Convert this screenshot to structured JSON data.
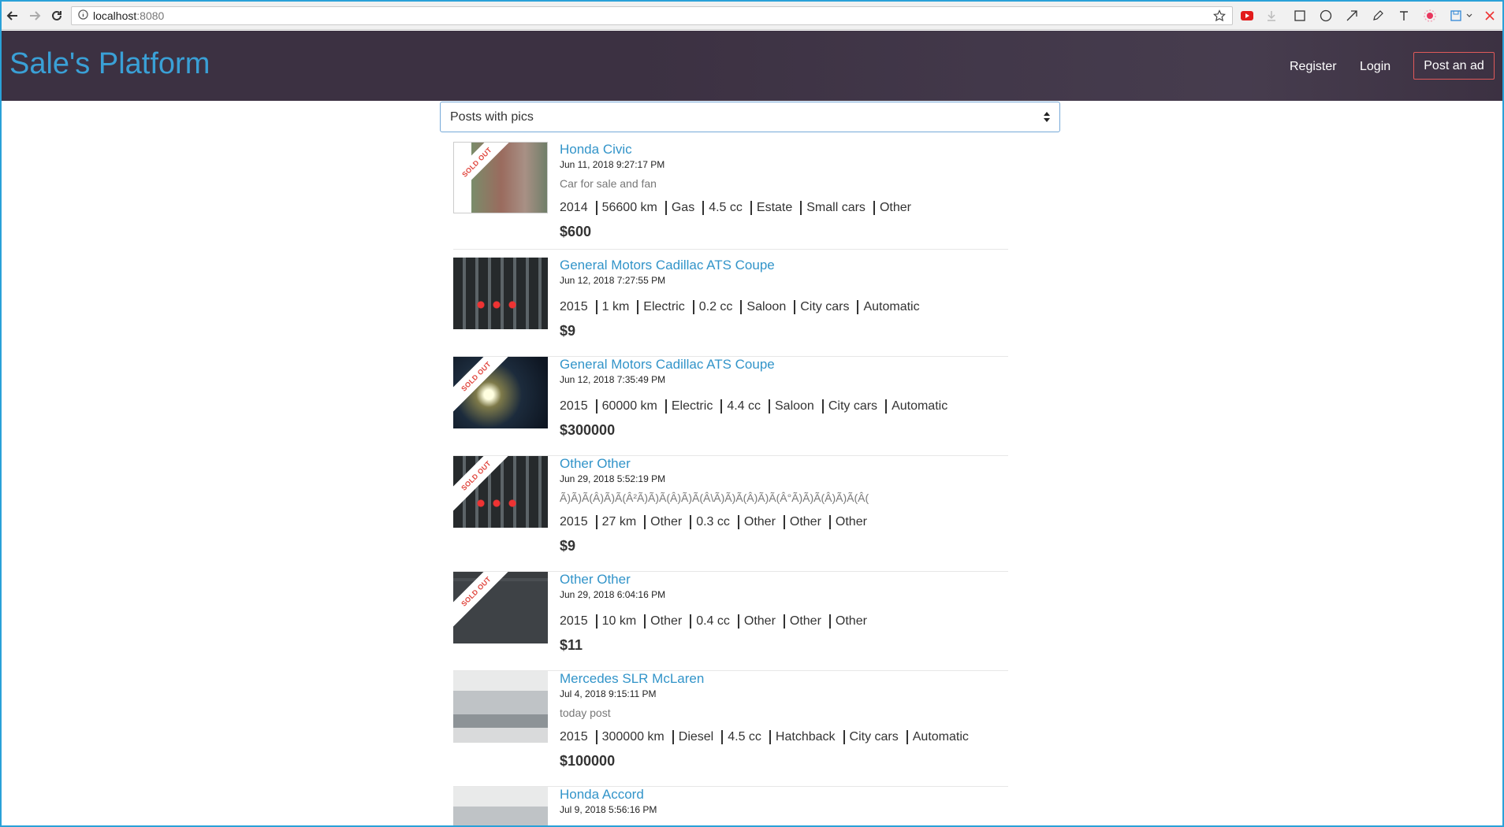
{
  "browser": {
    "url_host": "localhost",
    "url_port": ":8080"
  },
  "navbar": {
    "brand": "Sale's Platform",
    "register": "Register",
    "login": "Login",
    "post_ad": "Post an ad"
  },
  "filter": {
    "selected": "Posts with pics"
  },
  "sold_out_label": "SOLD OUT",
  "listings": [
    {
      "title": "Honda Civic",
      "date": "Jun 11, 2018 9:27:17 PM",
      "description": "Car for sale and fan",
      "specs": [
        "2014",
        "56600 km",
        "Gas",
        "4.5 cc",
        "Estate",
        "Small cars",
        "Other"
      ],
      "price": "$600",
      "sold_out": true,
      "photo": "train"
    },
    {
      "title": "General Motors Cadillac ATS Coupe",
      "date": "Jun 12, 2018 7:27:55 PM",
      "description": "",
      "specs": [
        "2015",
        "1 km",
        "Electric",
        "0.2 cc",
        "Saloon",
        "City cars",
        "Automatic"
      ],
      "price": "$9",
      "sold_out": false,
      "photo": "keyboard"
    },
    {
      "title": "General Motors Cadillac ATS Coupe",
      "date": "Jun 12, 2018 7:35:49 PM",
      "description": "",
      "specs": [
        "2015",
        "60000 km",
        "Electric",
        "4.4 cc",
        "Saloon",
        "City cars",
        "Automatic"
      ],
      "price": "$300000",
      "sold_out": true,
      "photo": "night"
    },
    {
      "title": "Other Other",
      "date": "Jun 29, 2018 5:52:19 PM",
      "description": "Ã)Ã)Ã(Â)Ã)Ã(Â²Ã)Ã)Ã(Â)Ã)Ã(Â\\Ã)Ã)Ã(Â)Ã)Ã(Â°Ã)Ã)Ã(Â)Ã)Ã(Â(",
      "specs": [
        "2015",
        "27 km",
        "Other",
        "0.3 cc",
        "Other",
        "Other",
        "Other"
      ],
      "price": "$9",
      "sold_out": true,
      "photo": "keyboard"
    },
    {
      "title": "Other Other",
      "date": "Jun 29, 2018 6:04:16 PM",
      "description": "",
      "specs": [
        "2015",
        "10 km",
        "Other",
        "0.4 cc",
        "Other",
        "Other",
        "Other"
      ],
      "price": "$11",
      "sold_out": true,
      "photo": "dark"
    },
    {
      "title": "Mercedes SLR McLaren",
      "date": "Jul 4, 2018 9:15:11 PM",
      "description": "today post",
      "specs": [
        "2015",
        "300000 km",
        "Diesel",
        "4.5 cc",
        "Hatchback",
        "City cars",
        "Automatic"
      ],
      "price": "$100000",
      "sold_out": false,
      "photo": "car"
    },
    {
      "title": "Honda Accord",
      "date": "Jul 9, 2018 5:56:16 PM",
      "description": "",
      "specs": [],
      "price": "",
      "sold_out": false,
      "photo": "car"
    }
  ]
}
